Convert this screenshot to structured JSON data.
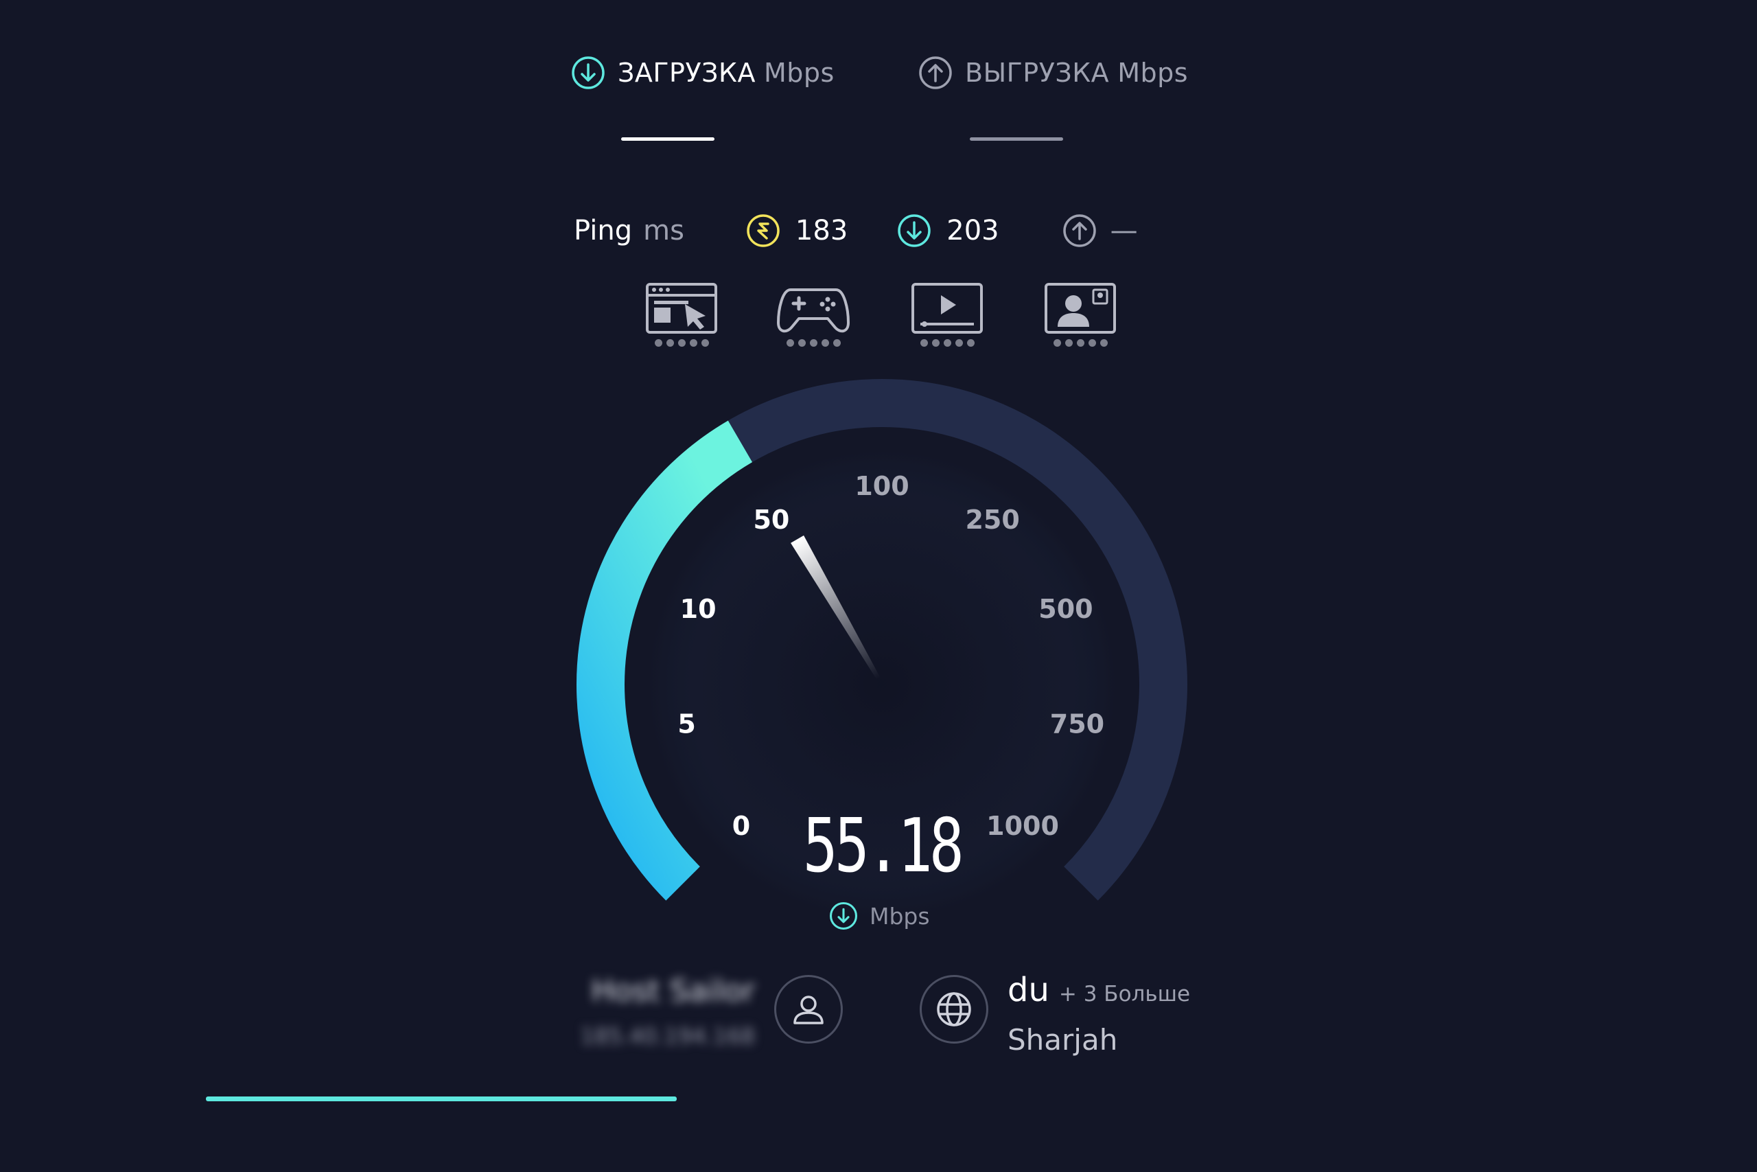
{
  "tabs": [
    {
      "label": "ЗАГРУЗКА",
      "unit": "Mbps",
      "icon": "download-icon",
      "active": true
    },
    {
      "label": "ВЫГРУЗКА",
      "unit": "Mbps",
      "icon": "upload-icon",
      "active": false
    }
  ],
  "ping": {
    "label": "Ping",
    "unit": "ms",
    "idle": "183",
    "download": "203",
    "upload": "—"
  },
  "categories": [
    {
      "icon": "web-browsing-icon"
    },
    {
      "icon": "gaming-icon"
    },
    {
      "icon": "video-streaming-icon"
    },
    {
      "icon": "video-chat-icon"
    }
  ],
  "gauge": {
    "ticks": [
      "0",
      "5",
      "10",
      "50",
      "100",
      "250",
      "500",
      "750",
      "1000"
    ],
    "value": "55.18",
    "unit": "Mbps",
    "needle_value": 55.18
  },
  "server": {
    "host": "Host Sailor",
    "ip": "185.40.194.168"
  },
  "isp": {
    "name": "du",
    "more": "+ 3 Больше",
    "location": "Sharjah"
  },
  "progress": 0.35,
  "colors": {
    "background": "#131627",
    "accent": "#5ee8df",
    "gauge_track": "#232c4a",
    "ping_idle": "#f2e35b"
  }
}
